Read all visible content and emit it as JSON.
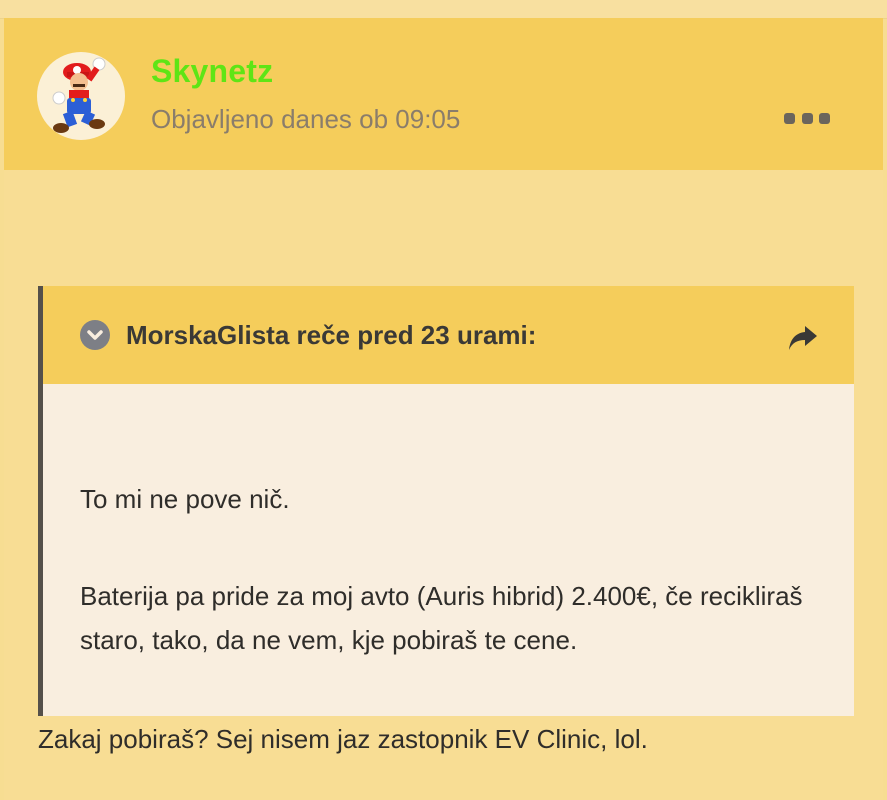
{
  "post": {
    "username": "Skynetz",
    "timestamp": "Objavljeno danes ob 09:05",
    "avatar_icon": "mario-avatar",
    "menu_icon": "more-options-icon",
    "username_color": "#5fe515",
    "quote": {
      "author_line": "MorskaGlista reče pred 23 urami:",
      "collapse_icon": "chevron-down-circle-icon",
      "share_icon": "share-arrow-icon",
      "paragraph1": "To mi ne pove nič.",
      "paragraph2": "Baterija pa pride za moj avto (Auris hibrid) 2.400€, če recikliraš staro, tako, da ne vem, kje pobiraš te cene."
    },
    "body": "Zakaj pobiraš? Sej nisem jaz zastopnik EV Clinic, lol."
  }
}
